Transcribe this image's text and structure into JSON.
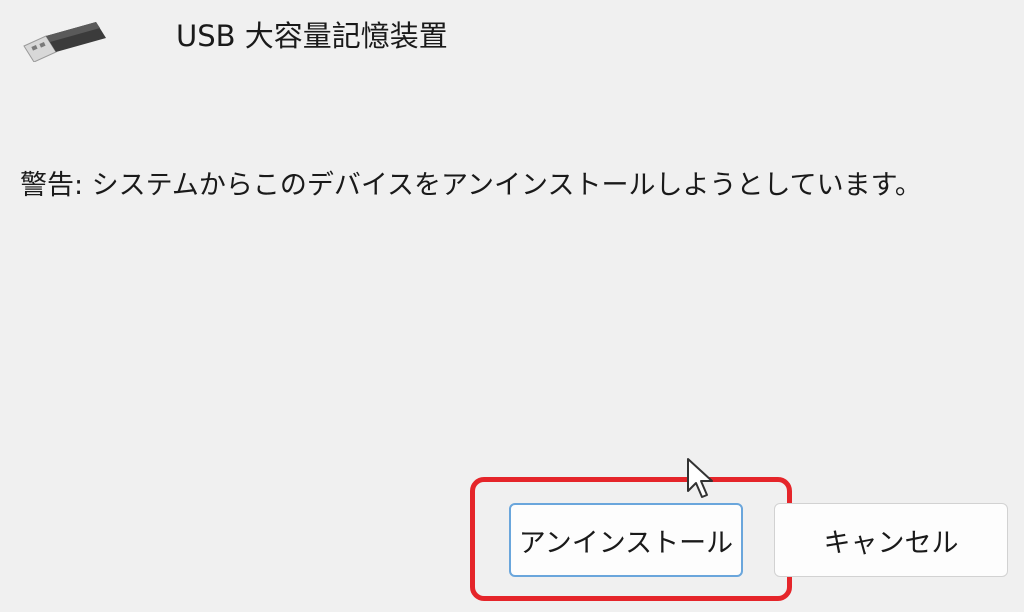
{
  "device": {
    "icon": "usb-drive-icon",
    "name": "USB 大容量記憶装置"
  },
  "warning": {
    "text": "警告: システムからこのデバイスをアンインストールしようとしています。"
  },
  "buttons": {
    "uninstall_label": "アンインストール",
    "cancel_label": "キャンセル"
  },
  "colors": {
    "background": "#f0f0f0",
    "highlight": "#e5252a",
    "focus_border": "#6aa6dc"
  }
}
